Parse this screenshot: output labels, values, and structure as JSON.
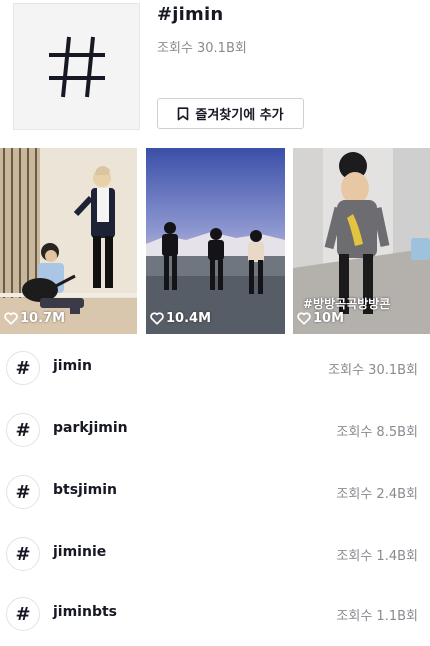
{
  "header": {
    "cover_icon": "hashtag-icon",
    "title": "#jimin",
    "views": "조회수 30.1B회",
    "favorite_icon": "bookmark-icon",
    "favorite_label": "즐겨찾기에 추가"
  },
  "videos": [
    {
      "likes": "10.7M",
      "caption": ""
    },
    {
      "likes": "10.4M",
      "caption": ""
    },
    {
      "likes": "10M",
      "caption": "#방방곡곡방방콘"
    }
  ],
  "related_tags": [
    {
      "name": "jimin",
      "views": "조회수 30.1B회"
    },
    {
      "name": "parkjimin",
      "views": "조회수 8.5B회"
    },
    {
      "name": "btsjimin",
      "views": "조회수 2.4B회"
    },
    {
      "name": "jiminie",
      "views": "조회수 1.4B회"
    },
    {
      "name": "jiminbts",
      "views": "조회수 1.1B회"
    }
  ],
  "hash_glyph": "#",
  "colors": {
    "text": "#161823",
    "muted": "#8a8b91"
  }
}
